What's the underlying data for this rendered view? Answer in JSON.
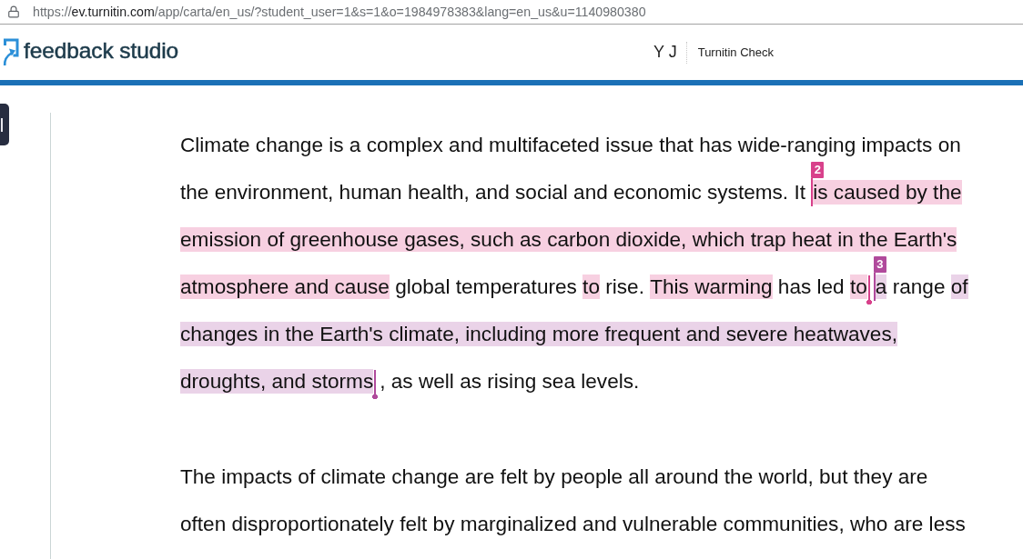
{
  "browser": {
    "url": {
      "scheme": "https://",
      "host": "ev.turnitin.com",
      "path": "/app/carta/en_us/?student_user=1&s=1&o=1984978383&lang=en_us&u=1140980380"
    }
  },
  "header": {
    "logo": "feedback studio",
    "user_initials": "Y J",
    "title": "Turnitin Check"
  },
  "document": {
    "paragraphs": [
      {
        "lines": [
          {
            "items": [
              {
                "kind": "text",
                "text": "Climate change is a complex and multifaceted issue that has wide-ranging impacts on"
              }
            ]
          },
          {
            "items": [
              {
                "kind": "text",
                "text": "the environment, human health, and social and economic systems. It "
              },
              {
                "kind": "match_start",
                "label": "2",
                "color": "#d8418b"
              },
              {
                "kind": "text",
                "text": "is caused by the",
                "color": "#f7d0e1"
              }
            ]
          },
          {
            "items": [
              {
                "kind": "text",
                "text": "emission of greenhouse gases, such as carbon dioxide, which trap heat in the Earth's",
                "color": "#f7d0e1"
              }
            ]
          },
          {
            "items": [
              {
                "kind": "text",
                "text": "atmosphere and cause",
                "color": "#f7d0e1"
              },
              {
                "kind": "text",
                "text": " global temperatures "
              },
              {
                "kind": "text",
                "text": "to",
                "color": "#f7d0e1"
              },
              {
                "kind": "text",
                "text": " rise. "
              },
              {
                "kind": "text",
                "text": "This warming",
                "color": "#f7d0e1"
              },
              {
                "kind": "text",
                "text": " has led "
              },
              {
                "kind": "text",
                "text": "to",
                "color": "#f7d0e1"
              },
              {
                "kind": "match_end",
                "color": "#d8418b"
              },
              {
                "kind": "match_start",
                "label": "3",
                "color": "#b04a9c"
              },
              {
                "kind": "text",
                "text": "a",
                "color": "#ead3e8"
              },
              {
                "kind": "text",
                "text": " range "
              },
              {
                "kind": "text",
                "text": "of",
                "color": "#ead3e8"
              }
            ]
          },
          {
            "items": [
              {
                "kind": "text",
                "text": "changes in the Earth's climate, including more frequent and severe heatwaves,",
                "color": "#ead3e8"
              }
            ]
          },
          {
            "items": [
              {
                "kind": "text",
                "text": "droughts, and storms",
                "color": "#ead3e8"
              },
              {
                "kind": "match_end",
                "color": "#b04a9c"
              },
              {
                "kind": "text",
                "text": ", as well as rising sea levels."
              }
            ]
          }
        ]
      },
      {
        "lines": [
          {
            "items": [
              {
                "kind": "text",
                "text": "The impacts of climate change are felt by people all around the world, but they are"
              }
            ]
          },
          {
            "items": [
              {
                "kind": "text",
                "text": "often disproportionately felt by marginalized and vulnerable communities, who are less"
              }
            ]
          }
        ]
      }
    ]
  }
}
